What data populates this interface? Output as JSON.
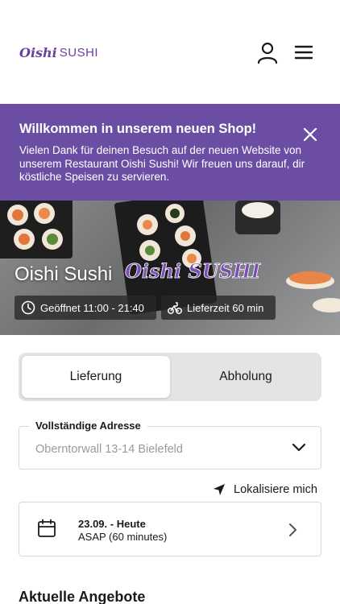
{
  "brand": {
    "logo_prefix": "Oishi",
    "logo_suffix": "SUSHI",
    "accent": "#6b4ea3"
  },
  "header": {
    "user_icon": "user-icon",
    "menu_icon": "menu-icon"
  },
  "banner": {
    "title": "Willkommen in unserem neuen Shop!",
    "text": "Vielen Dank für deinen Besuch auf der neuen Website von unserem Restaurant Oishi Sushi! Wir freuen uns darauf, dir köstliche Speisen zu servieren.",
    "close_icon": "close-icon",
    "background": "#6b4ea3"
  },
  "hero": {
    "restaurant_name": "Oishi Sushi",
    "logo_text": "Oishi SUSHI",
    "opening_hours": "Geöffnet 11:00 - 21:40",
    "delivery_time": "Lieferzeit 60 min",
    "clock_icon": "clock-icon",
    "delivery_icon": "bicycle-icon"
  },
  "order_type": {
    "options": [
      "Lieferung",
      "Abholung"
    ],
    "selected": "Lieferung"
  },
  "address": {
    "label": "Vollständige Adresse",
    "placeholder": "Oberntorwall 13-14 Bielefeld"
  },
  "locate": {
    "label": "Lokalisiere mich",
    "icon": "location-arrow-icon"
  },
  "schedule": {
    "date": "23.09. - Heute",
    "time": "ASAP (60 minutes)",
    "icon": "calendar-icon"
  },
  "offers": {
    "title": "Aktuelle Angebote"
  }
}
